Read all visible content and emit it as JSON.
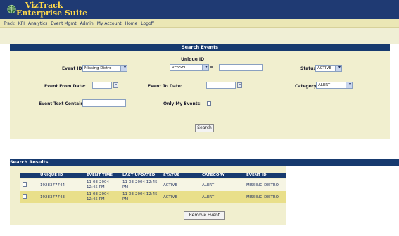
{
  "app": {
    "title_line1": "VizTrack",
    "title_line2": "Enterprise Suite"
  },
  "nav": {
    "items": [
      "Track",
      "KPI",
      "Analytics",
      "Event Mgmt",
      "Admin",
      "My Account",
      "Home",
      "Logoff"
    ]
  },
  "search": {
    "header": "Search Events",
    "unique_id_label": "Unique ID",
    "unique_id_type": "VESSEL",
    "unique_id_separator": "=",
    "unique_id_value": "",
    "event_id_label": "Event ID:",
    "event_id_value": "Missing Distro",
    "status_label": "Status:",
    "status_value": "ACTIVE",
    "event_from_label": "Event From Date:",
    "event_from_value": "",
    "event_to_label": "Event To Date:",
    "event_to_value": "",
    "category_label": "Category",
    "category_value": "ALERT",
    "text_contains_label": "Event Text Contains:",
    "text_contains_value": "",
    "only_my_events_label": "Only My Events:",
    "search_button": "Search"
  },
  "results": {
    "header": "Search Results",
    "columns": [
      "UNIQUE ID",
      "EVENT TIME",
      "LAST UPDATED",
      "STATUS",
      "CATEGORY",
      "EVENT ID"
    ],
    "rows": [
      {
        "unique_id": "1928377744",
        "event_time_1": "11-03-2004",
        "event_time_2": "12:45 PM",
        "last_updated_1": "11-03-2004 12:45",
        "last_updated_2": "PM",
        "status": "ACTIVE",
        "category": "ALERT",
        "event_id": "MISSING DISTRO"
      },
      {
        "unique_id": "1928377743",
        "event_time_1": "11-03-2004",
        "event_time_2": "12:45 PM",
        "last_updated_1": "11-03-2004 12:45",
        "last_updated_2": "PM",
        "status": "ACTIVE",
        "category": "ALERT",
        "event_id": "MISSING DISTRO"
      }
    ],
    "remove_button": "Remove Event"
  },
  "colors": {
    "header_navy": "#1f3a73",
    "title_gold": "#ffd94a",
    "panel_bg": "#f1efcf",
    "highlight_row": "#e9df8a"
  }
}
